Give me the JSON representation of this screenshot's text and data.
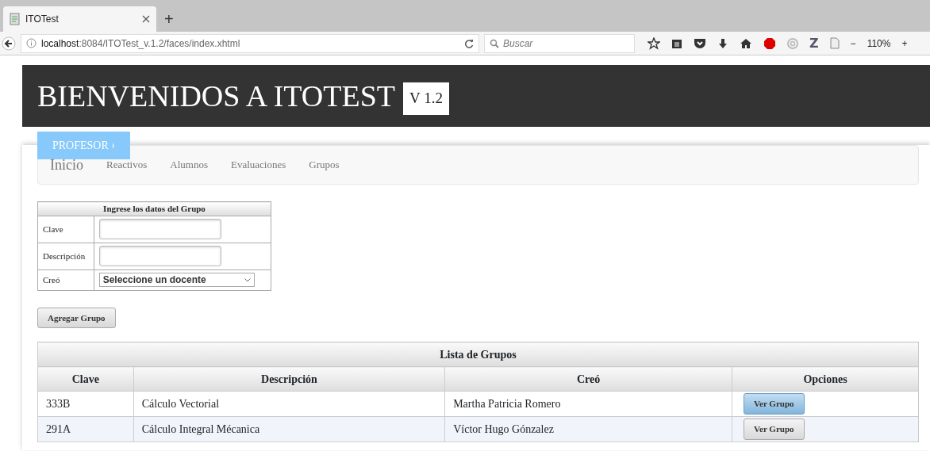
{
  "browser": {
    "tab_title": "ITOTest",
    "new_tab": "+",
    "url_host": "localhost",
    "url_path": ":8084/ITOTest_v.1.2/faces/index.xhtml",
    "search_placeholder": "Buscar",
    "z_button": "Z",
    "zoom_out": "−",
    "zoom": "110%",
    "zoom_in": "+"
  },
  "header": {
    "title": "BIENVENIDOS A ITOTEST",
    "version": "V 1.2",
    "role_tab": "PROFESOR ›"
  },
  "nav": {
    "brand": "Inicio",
    "items": [
      "Reactivos",
      "Alumnos",
      "Evaluaciones",
      "Grupos"
    ]
  },
  "form": {
    "title": "Ingrese los datos del Grupo",
    "fields": [
      {
        "label": "Clave",
        "kind": "text"
      },
      {
        "label": "Descripción",
        "kind": "text"
      },
      {
        "label": "Creó",
        "kind": "select",
        "value": "Seleccione un docente"
      }
    ],
    "button": "Agregar Grupo"
  },
  "table": {
    "caption": "Lista de Grupos",
    "columns": [
      "Clave",
      "Descripción",
      "Creó",
      "Opciones"
    ],
    "rows": [
      {
        "cells": [
          "333B",
          "Cálculo Vectorial",
          "Martha Patricia Romero"
        ],
        "button": "Ver Grupo",
        "button_highlighted": true
      },
      {
        "cells": [
          "291A",
          "Cálculo Integral Mécanica",
          "Víctor Hugo Gónzalez"
        ],
        "button": "Ver Grupo",
        "button_highlighted": false
      }
    ]
  }
}
